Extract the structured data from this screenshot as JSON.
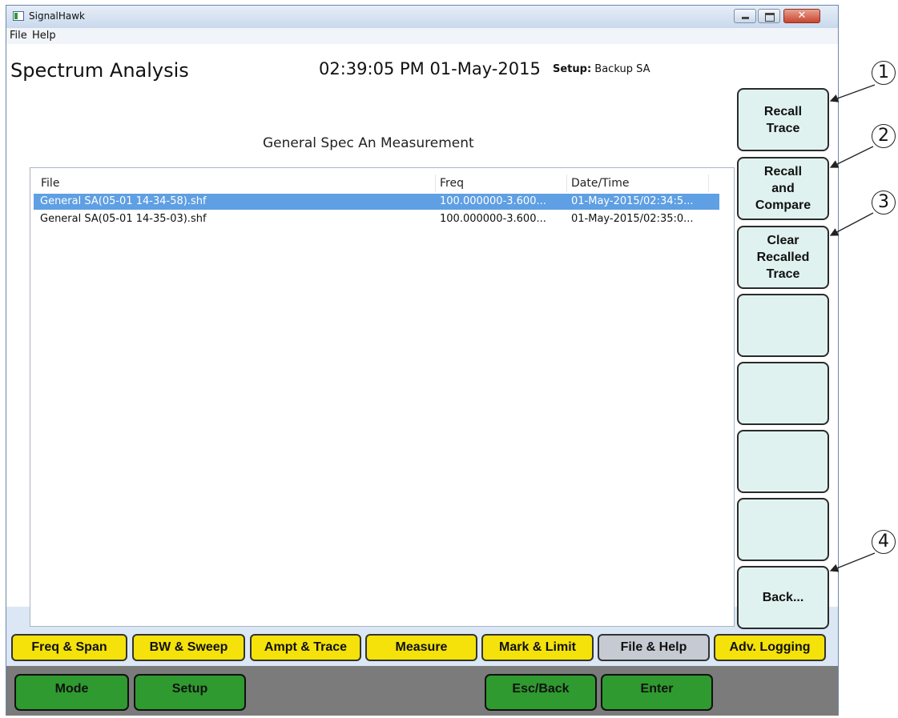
{
  "window": {
    "title": "SignalHawk",
    "controls": [
      "minimize-icon",
      "maximize-icon",
      "close-icon"
    ]
  },
  "menu": {
    "items": [
      "File",
      "Help"
    ]
  },
  "header": {
    "mode_title": "Spectrum Analysis",
    "datetime": "02:39:05 PM 01-May-2015",
    "setup_label": "Setup:",
    "setup_value": "Backup SA"
  },
  "main": {
    "title": "General Spec An Measurement",
    "columns": [
      "File",
      "Freq",
      "Date/Time"
    ],
    "rows": [
      {
        "file": "General SA(05-01 14-34-58).shf",
        "freq": "100.000000-3.600...",
        "datetime": "01-May-2015/02:34:5...",
        "selected": true
      },
      {
        "file": "General SA(05-01 14-35-03).shf",
        "freq": "100.000000-3.600...",
        "datetime": "01-May-2015/02:35:0...",
        "selected": false
      }
    ]
  },
  "softkeys": {
    "k1": "Recall\nTrace",
    "k2": "Recall\nand\nCompare",
    "k3": "Clear\nRecalled\nTrace",
    "k4": "",
    "k5": "",
    "k6": "",
    "k7": "",
    "k8": "Back..."
  },
  "tabs": {
    "t1": "Freq & Span",
    "t2": "BW & Sweep",
    "t3": "Ampt &  Trace",
    "t4": "Measure",
    "t5": "Mark & Limit",
    "t6": "File & Help",
    "t7": "Adv. Logging",
    "active": "File & Help"
  },
  "bottom": {
    "mode": "Mode",
    "setup": "Setup",
    "esc": "Esc/Back",
    "enter": "Enter"
  },
  "callouts": [
    "1",
    "2",
    "3",
    "4"
  ],
  "colors": {
    "tab_yellow": "#f4e20a",
    "tab_active": "#c6cbd3",
    "softkey_bg": "#dff2ef",
    "bottom_green": "#2f9a2f",
    "selection_blue": "#5f9fe3"
  }
}
